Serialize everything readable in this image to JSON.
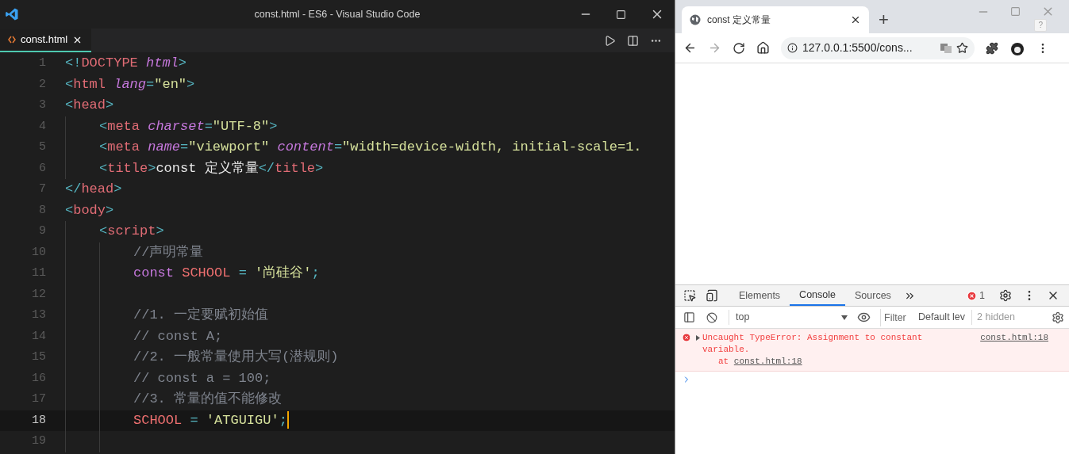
{
  "editor": {
    "window_title": "const.html - ES6 - Visual Studio Code",
    "tabs": [
      {
        "label": "const.html",
        "selected": true
      }
    ],
    "lines": [
      {
        "number": "1",
        "current": false,
        "tokens": [
          {
            "kind": "punct",
            "text": "<!"
          },
          {
            "kind": "tag",
            "text": "DOCTYPE "
          },
          {
            "kind": "attr",
            "text": "html"
          },
          {
            "kind": "punct",
            "text": ">"
          }
        ]
      },
      {
        "number": "2",
        "current": false,
        "tokens": [
          {
            "kind": "punct",
            "text": "<"
          },
          {
            "kind": "tag",
            "text": "html "
          },
          {
            "kind": "attr",
            "text": "lang"
          },
          {
            "kind": "punct",
            "text": "="
          },
          {
            "kind": "string",
            "text": "\"en\""
          },
          {
            "kind": "punct",
            "text": ">"
          }
        ]
      },
      {
        "number": "3",
        "current": false,
        "tokens": [
          {
            "kind": "punct",
            "text": "<"
          },
          {
            "kind": "tag",
            "text": "head"
          },
          {
            "kind": "punct",
            "text": ">"
          }
        ],
        "children": [
          {
            "number": "4",
            "current": false,
            "tokens": [
              {
                "kind": "punct",
                "text": "<"
              },
              {
                "kind": "tag",
                "text": "meta "
              },
              {
                "kind": "attr",
                "text": "charset"
              },
              {
                "kind": "punct",
                "text": "="
              },
              {
                "kind": "string",
                "text": "\"UTF-8\""
              },
              {
                "kind": "punct",
                "text": ">"
              }
            ]
          },
          {
            "number": "5",
            "current": false,
            "tokens": [
              {
                "kind": "punct",
                "text": "<"
              },
              {
                "kind": "tag",
                "text": "meta "
              },
              {
                "kind": "attr",
                "text": "name"
              },
              {
                "kind": "punct",
                "text": "="
              },
              {
                "kind": "string",
                "text": "\"viewport\" "
              },
              {
                "kind": "attr",
                "text": "content"
              },
              {
                "kind": "punct",
                "text": "="
              },
              {
                "kind": "string",
                "text": "\"width=device-width, initial-scale=1."
              }
            ]
          },
          {
            "number": "6",
            "current": false,
            "tokens": [
              {
                "kind": "punct",
                "text": "<"
              },
              {
                "kind": "tag",
                "text": "title"
              },
              {
                "kind": "punct",
                "text": ">"
              },
              {
                "kind": "text",
                "text": "const 定义常量"
              },
              {
                "kind": "punct",
                "text": "</"
              },
              {
                "kind": "tag",
                "text": "title"
              },
              {
                "kind": "punct",
                "text": ">"
              }
            ]
          }
        ]
      },
      {
        "number": "7",
        "current": false,
        "tokens": [
          {
            "kind": "punct",
            "text": "</"
          },
          {
            "kind": "tag",
            "text": "head"
          },
          {
            "kind": "punct",
            "text": ">"
          }
        ]
      },
      {
        "number": "8",
        "current": false,
        "tokens": [
          {
            "kind": "punct",
            "text": "<"
          },
          {
            "kind": "tag",
            "text": "body"
          },
          {
            "kind": "punct",
            "text": ">"
          }
        ],
        "children": [
          {
            "number": "9",
            "current": false,
            "tokens": [
              {
                "kind": "punct",
                "text": "<"
              },
              {
                "kind": "tag",
                "text": "script"
              },
              {
                "kind": "punct",
                "text": ">"
              }
            ],
            "children": [
              {
                "number": "10",
                "current": false,
                "tokens": [
                  {
                    "kind": "comment",
                    "text": "//声明常量"
                  }
                ]
              },
              {
                "number": "11",
                "current": false,
                "tokens": [
                  {
                    "kind": "keyword",
                    "text": "const "
                  },
                  {
                    "kind": "constant",
                    "text": "SCHOOL "
                  },
                  {
                    "kind": "punct",
                    "text": "= "
                  },
                  {
                    "kind": "string",
                    "text": "'尚硅谷'"
                  },
                  {
                    "kind": "punct",
                    "text": ";"
                  }
                ]
              },
              {
                "number": "12",
                "current": false
              },
              {
                "number": "13",
                "current": false,
                "tokens": [
                  {
                    "kind": "comment",
                    "text": "//1. 一定要赋初始值"
                  }
                ]
              },
              {
                "number": "14",
                "current": false,
                "tokens": [
                  {
                    "kind": "comment",
                    "text": "// const A;"
                  }
                ]
              },
              {
                "number": "15",
                "current": false,
                "tokens": [
                  {
                    "kind": "comment",
                    "text": "//2. 一般常量使用大写(潜规则)"
                  }
                ]
              },
              {
                "number": "16",
                "current": false,
                "tokens": [
                  {
                    "kind": "comment",
                    "text": "// const a = 100;"
                  }
                ]
              },
              {
                "number": "17",
                "current": false,
                "tokens": [
                  {
                    "kind": "comment",
                    "text": "//3. 常量的值不能修改"
                  }
                ]
              },
              {
                "number": "18",
                "current": true,
                "tokens": [
                  {
                    "kind": "constant",
                    "text": "SCHOOL "
                  },
                  {
                    "kind": "punct",
                    "text": "= "
                  },
                  {
                    "kind": "string",
                    "text": "'ATGUIGU'"
                  },
                  {
                    "kind": "punct",
                    "text": ";"
                  }
                ]
              },
              {
                "number": "19",
                "current": false
              }
            ]
          }
        ]
      }
    ]
  },
  "browser": {
    "tab_title": "const 定义常量",
    "new_tab": "+",
    "help_badge": "?",
    "url": "127.0.0.1:5500/cons...",
    "devtools": {
      "tabs": [
        {
          "label": "Elements",
          "selected": false
        },
        {
          "label": "Console",
          "selected": true
        },
        {
          "label": "Sources",
          "selected": false
        }
      ],
      "error_count": "1",
      "context": "top",
      "filter_placeholder": "Filter",
      "levels": "Default lev",
      "hidden": "2 hidden",
      "messages": [
        {
          "kind": "error",
          "text": "Uncaught TypeError: Assignment to constant variable.",
          "source": "const.html:18",
          "stack_prefix": "at",
          "stack_link": "const.html:18"
        }
      ]
    }
  }
}
